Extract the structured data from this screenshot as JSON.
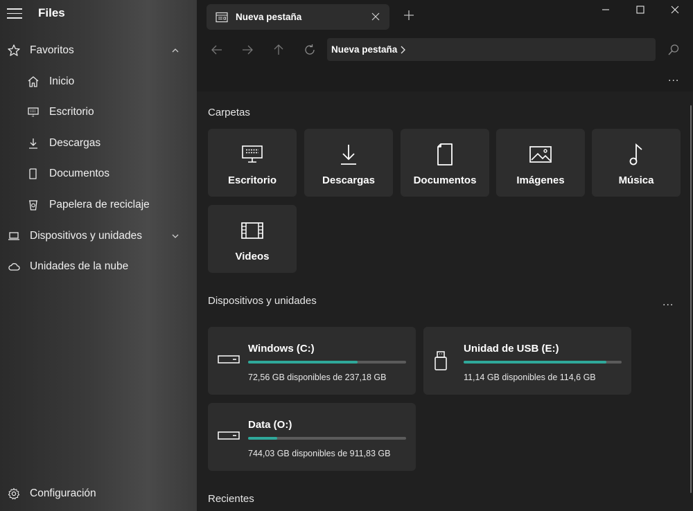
{
  "app": {
    "title": "Files"
  },
  "sidebar": {
    "items": [
      {
        "label": "Favoritos",
        "icon": "star-icon",
        "level": 0,
        "chevron": "up"
      },
      {
        "label": "Inicio",
        "icon": "home-icon",
        "level": 1
      },
      {
        "label": "Escritorio",
        "icon": "desktop-icon",
        "level": 1
      },
      {
        "label": "Descargas",
        "icon": "download-icon",
        "level": 1
      },
      {
        "label": "Documentos",
        "icon": "document-icon",
        "level": 1
      },
      {
        "label": "Papelera de reciclaje",
        "icon": "recycle-bin-icon",
        "level": 1
      },
      {
        "label": "Dispositivos y unidades",
        "icon": "laptop-icon",
        "level": 0,
        "chevron": "down"
      },
      {
        "label": "Unidades de la nube",
        "icon": "cloud-icon",
        "level": 0
      }
    ],
    "settings_label": "Configuración"
  },
  "tab": {
    "label": "Nueva pestaña"
  },
  "address": {
    "label": "Nueva pestaña"
  },
  "sections": {
    "folders_title": "Carpetas",
    "drives_title": "Dispositivos y unidades",
    "recent_title": "Recientes"
  },
  "folders": [
    {
      "label": "Escritorio",
      "icon": "desktop-icon"
    },
    {
      "label": "Descargas",
      "icon": "download-icon"
    },
    {
      "label": "Documentos",
      "icon": "document-icon"
    },
    {
      "label": "Imágenes",
      "icon": "image-icon"
    },
    {
      "label": "Música",
      "icon": "music-note-icon"
    },
    {
      "label": "Videos",
      "icon": "film-icon"
    }
  ],
  "drives": [
    {
      "name": "Windows (C:)",
      "free_text": "72,56 GB disponibles de 237,18 GB",
      "used_fraction": 0.694,
      "icon": "hard-drive-icon"
    },
    {
      "name": "Unidad de USB (E:)",
      "free_text": "11,14 GB disponibles de 114,6 GB",
      "used_fraction": 0.903,
      "icon": "usb-drive-icon"
    },
    {
      "name": "Data (O:)",
      "free_text": "744,03 GB disponibles de 911,83 GB",
      "used_fraction": 0.184,
      "icon": "hard-drive-icon"
    }
  ],
  "colors": {
    "accent": "#2fa89a",
    "card": "#2d2d2d",
    "background": "#202020"
  },
  "more_glyph": "..."
}
